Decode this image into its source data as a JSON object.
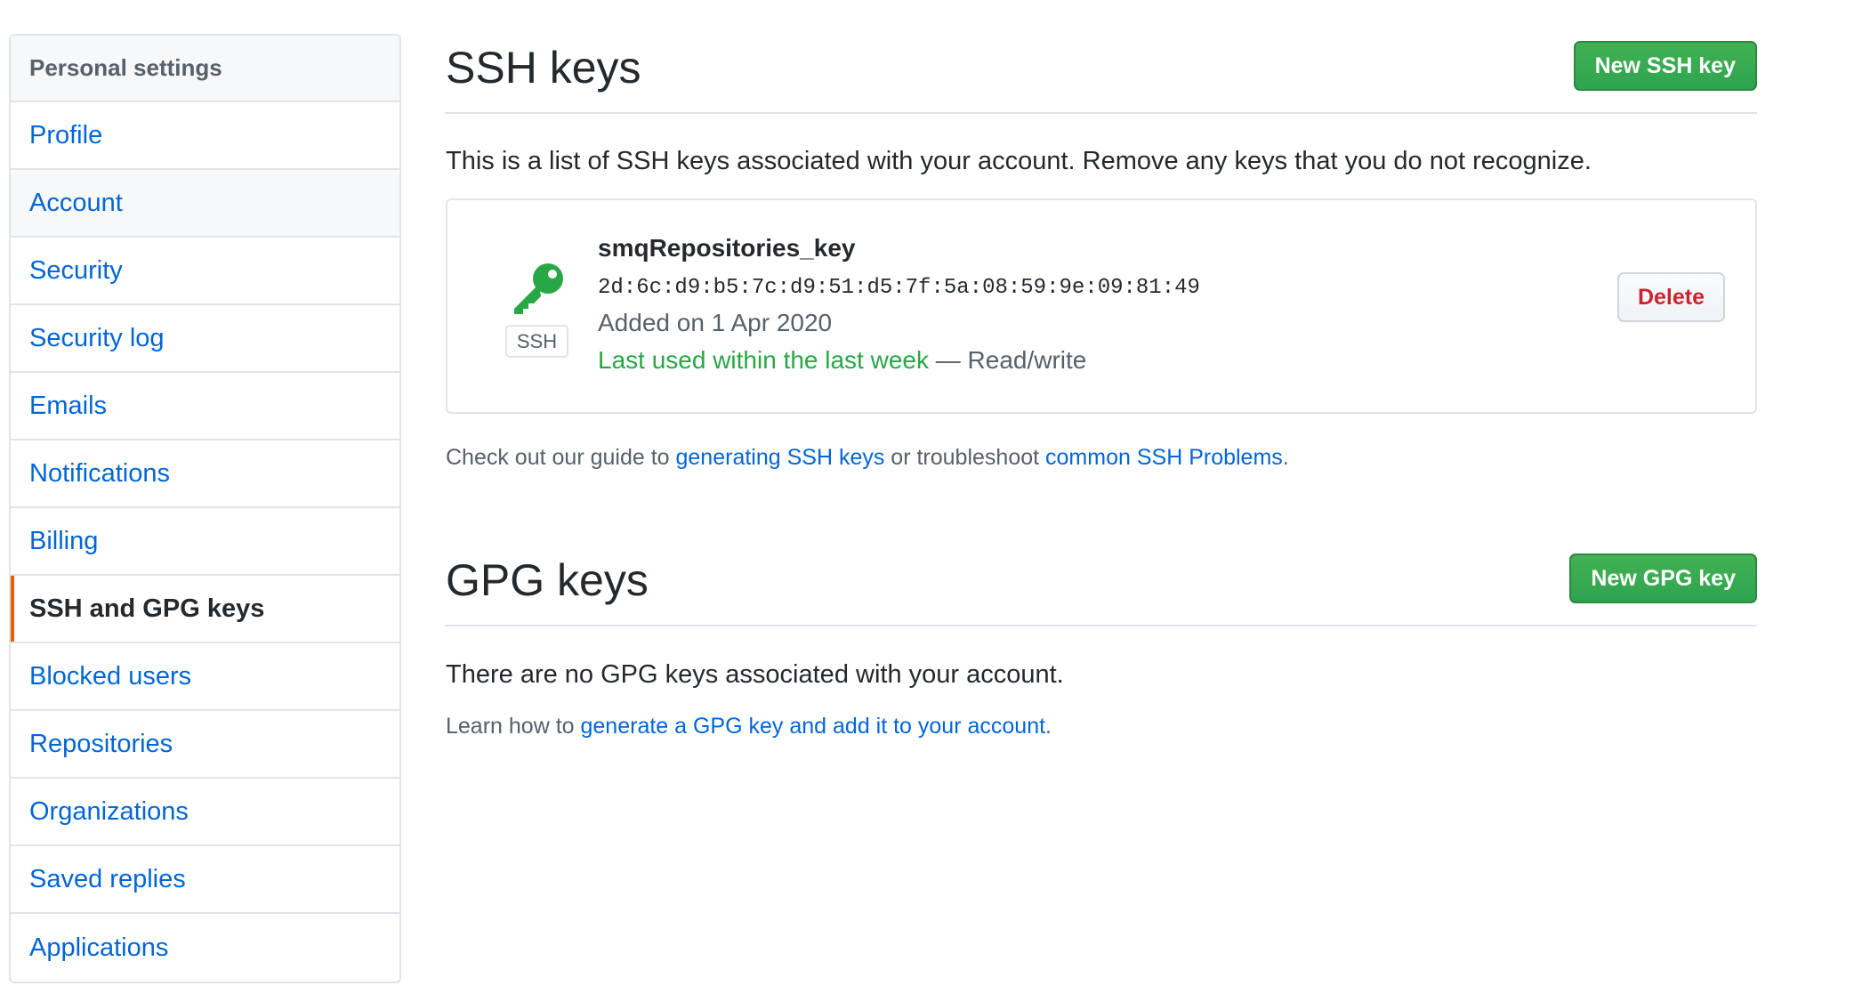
{
  "sidebar": {
    "header": "Personal settings",
    "items": [
      {
        "label": "Profile"
      },
      {
        "label": "Account"
      },
      {
        "label": "Security"
      },
      {
        "label": "Security log"
      },
      {
        "label": "Emails"
      },
      {
        "label": "Notifications"
      },
      {
        "label": "Billing"
      },
      {
        "label": "SSH and GPG keys"
      },
      {
        "label": "Blocked users"
      },
      {
        "label": "Repositories"
      },
      {
        "label": "Organizations"
      },
      {
        "label": "Saved replies"
      },
      {
        "label": "Applications"
      }
    ],
    "active_item": "SSH and GPG keys",
    "hovered_item": "Account"
  },
  "ssh": {
    "title": "SSH keys",
    "new_button": "New SSH key",
    "description": "This is a list of SSH keys associated with your account. Remove any keys that you do not recognize.",
    "key": {
      "icon": "key-icon",
      "type_label": "SSH",
      "name": "smqRepositories_key",
      "fingerprint": "2d:6c:d9:b5:7c:d9:51:d5:7f:5a:08:59:9e:09:81:49",
      "added": "Added on 1 Apr 2020",
      "last_used": "Last used within the last week",
      "access": " — Read/write",
      "delete_button": "Delete"
    },
    "guide": {
      "prefix": "Check out our guide to ",
      "link1": "generating SSH keys",
      "middle": " or troubleshoot ",
      "link2": "common SSH Problems",
      "suffix": "."
    }
  },
  "gpg": {
    "title": "GPG keys",
    "new_button": "New GPG key",
    "empty_text": "There are no GPG keys associated with your account.",
    "learn": {
      "prefix": "Learn how to ",
      "link": "generate a GPG key and add it to your account",
      "suffix": "."
    }
  },
  "colors": {
    "accent_active": "#e36209",
    "link": "#0366d6",
    "green_button": "#2ea44f",
    "danger": "#cb2431",
    "success_text": "#28a745"
  }
}
